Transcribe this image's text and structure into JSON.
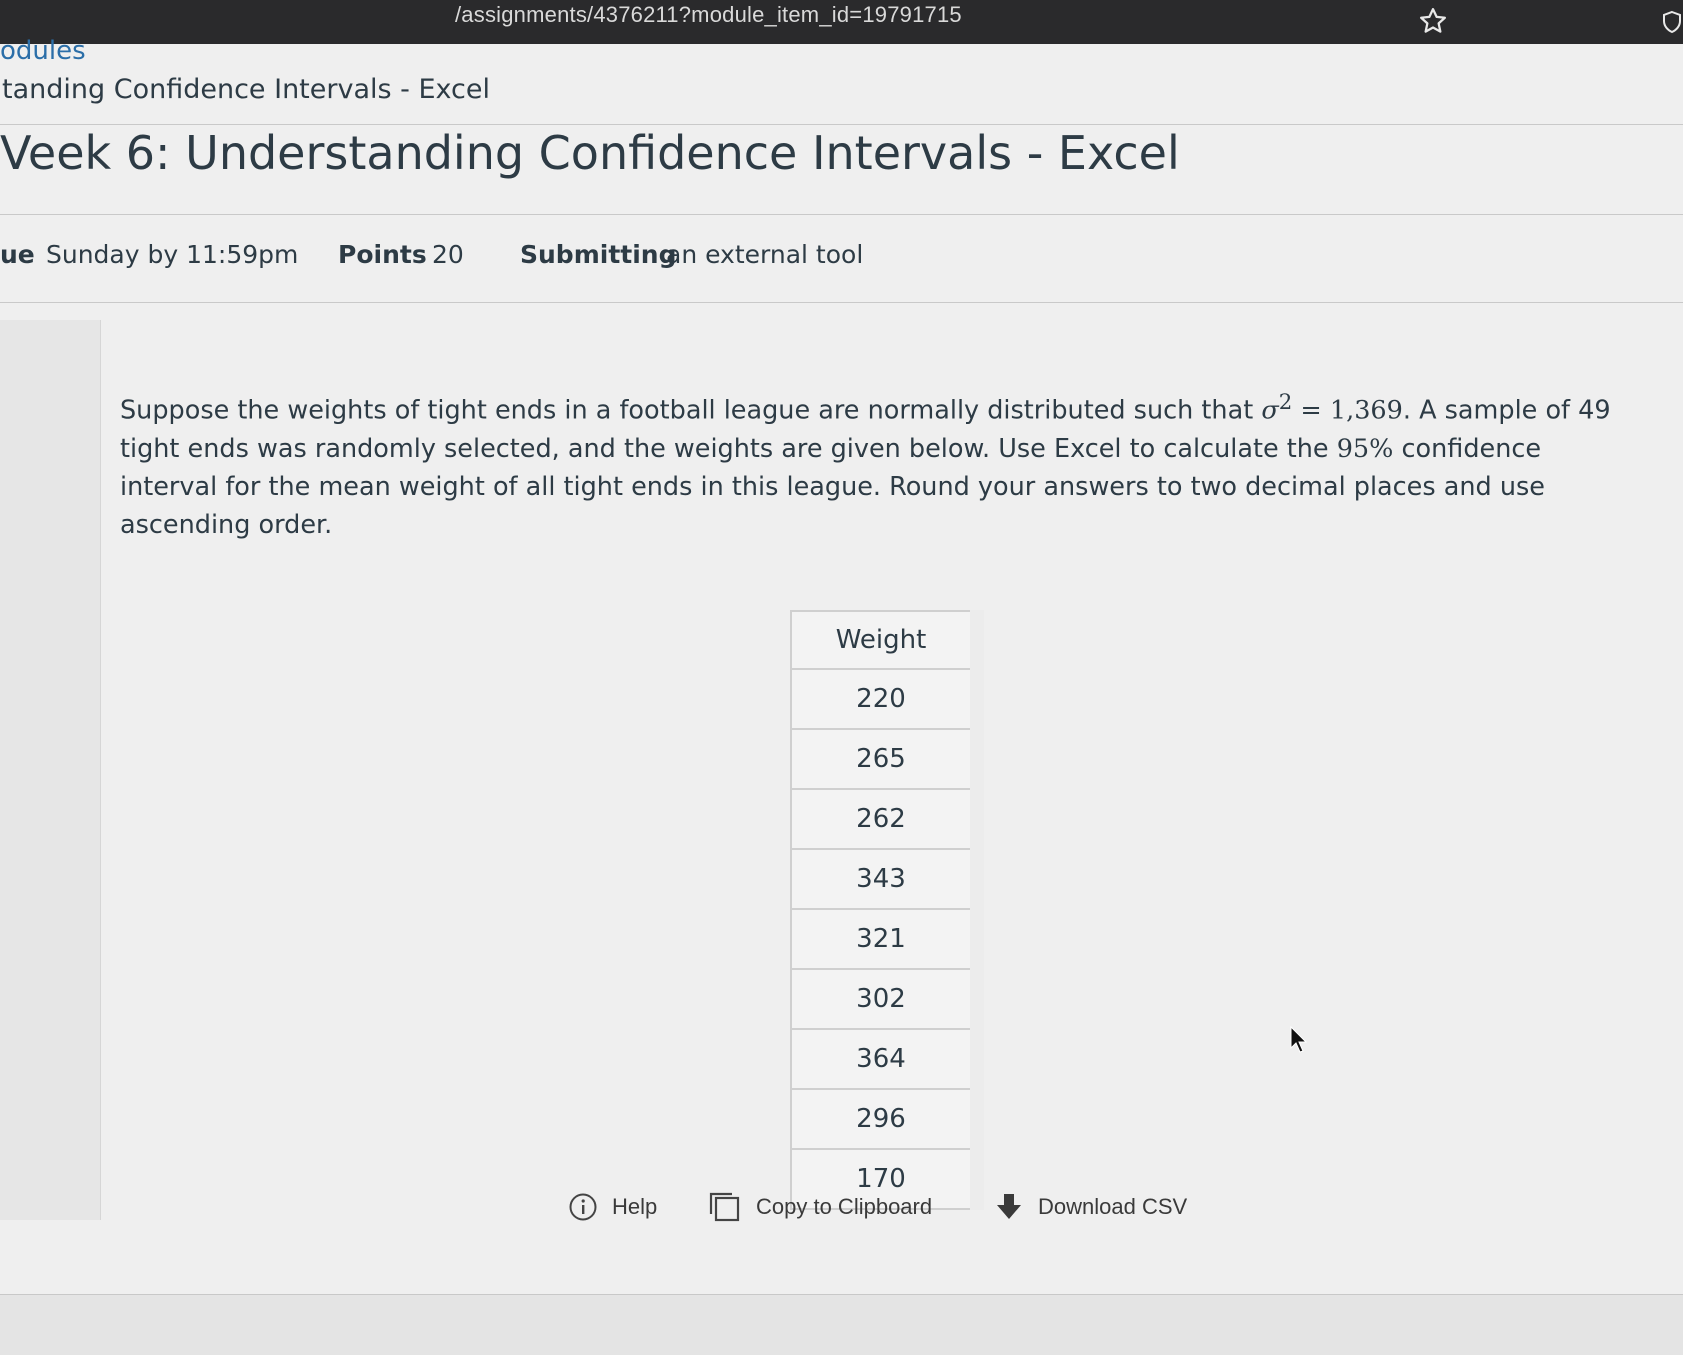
{
  "browser": {
    "url_visible": "/assignments/4376211?module_item_id=19791715",
    "star_icon": "star-outline-icon",
    "extension_icon": "shield-icon"
  },
  "breadcrumb": {
    "modules": "odules",
    "assignment": "tanding Confidence Intervals - Excel"
  },
  "page_title": "Veek 6: Understanding Confidence Intervals - Excel",
  "meta": {
    "due_label": "ue",
    "due_value": "Sunday by 11:59pm",
    "points_label": "Points",
    "points_value": "20",
    "submitting_label": "Submitting",
    "submitting_value": "an external tool"
  },
  "question": {
    "part1": "Suppose the weights of tight ends in a football league are normally distributed such that",
    "sigma": "σ",
    "exp": "2",
    "eq": " = 1,369",
    "part2": ". A sample of 49 tight ends was randomly selected, and the weights are given below. Use Excel to calculate the",
    "pct": "95%",
    "part3": "confidence interval for the mean weight of all tight ends in this league. Round your answers to two decimal places and use ascending order."
  },
  "table": {
    "header": "Weight",
    "rows": [
      "220",
      "265",
      "262",
      "343",
      "321",
      "302",
      "364",
      "296",
      "170"
    ]
  },
  "toolbar": {
    "help": "Help",
    "copy": "Copy to Clipboard",
    "download": "Download CSV"
  },
  "colors": {
    "link": "#2b6ea8",
    "text": "#2d3b45",
    "browser_bar": "#2a2a2c"
  }
}
